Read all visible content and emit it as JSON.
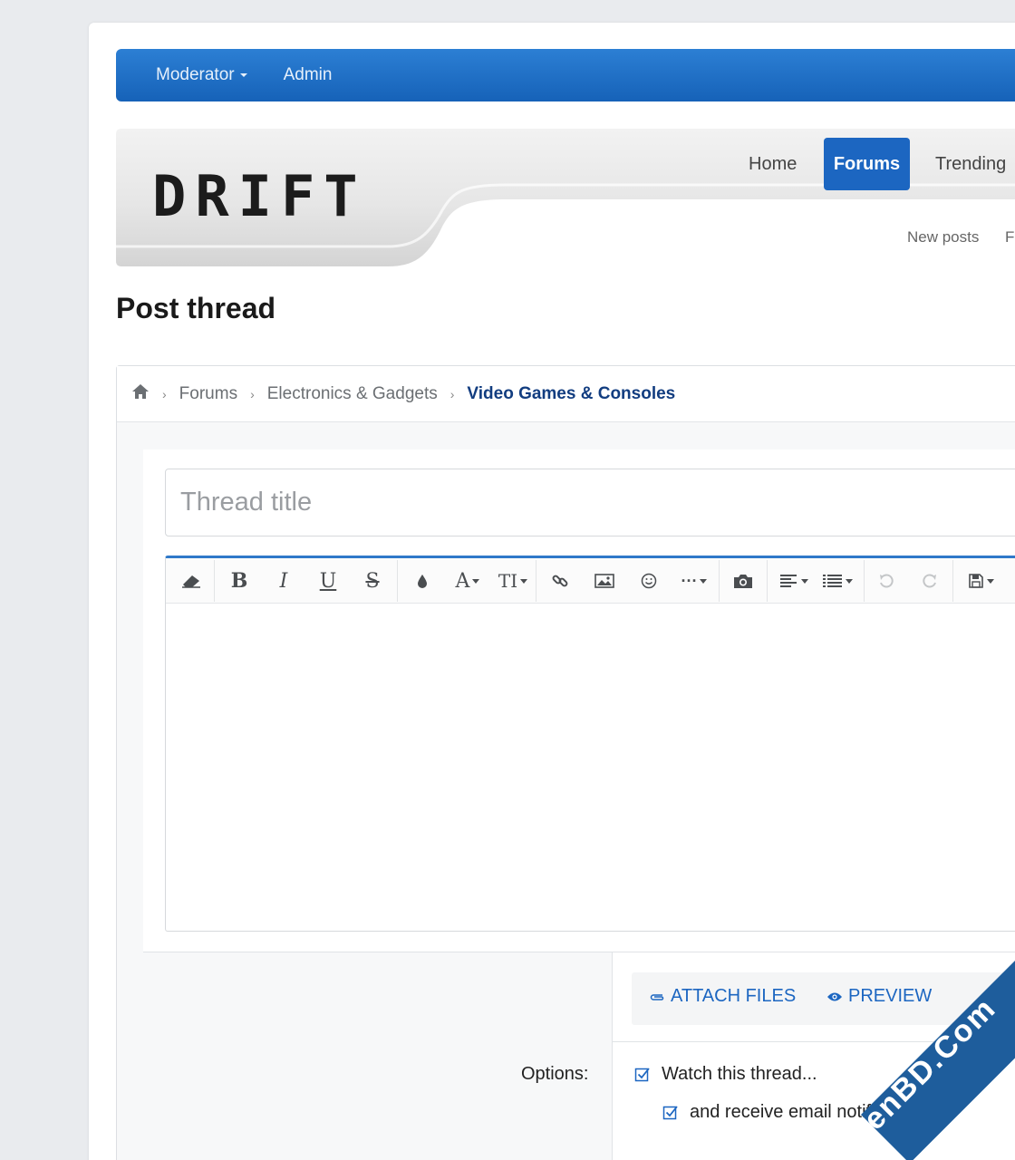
{
  "staff_bar": {
    "moderator": "Moderator",
    "admin": "Admin"
  },
  "header": {
    "logo": "DRIFT"
  },
  "nav": {
    "home": "Home",
    "forums": "Forums",
    "trending": "Trending"
  },
  "subnav": {
    "new_posts": "New posts",
    "next_partial": "F"
  },
  "page": {
    "title": "Post thread"
  },
  "breadcrumb": {
    "home_icon": "home-icon",
    "items": [
      "Forums",
      "Electronics & Gadgets",
      "Video Games & Consoles"
    ]
  },
  "form": {
    "title_placeholder": "Thread title",
    "attach_files": "ATTACH FILES",
    "preview": "PREVIEW",
    "options_label": "Options:",
    "watch_thread": "Watch this thread...",
    "email_notifications": "and receive email notifications"
  },
  "toolbar": {
    "icons": [
      "eraser-icon",
      "bold-icon",
      "italic-icon",
      "underline-icon",
      "strikethrough-icon",
      "color-icon",
      "font-family-icon",
      "font-size-icon",
      "link-icon",
      "image-icon",
      "smilie-icon",
      "more-icon",
      "media-icon",
      "align-icon",
      "list-icon",
      "undo-icon",
      "redo-icon",
      "drafts-icon"
    ]
  },
  "colors": {
    "accent": "#1c66c1",
    "breadcrumb_current": "#123d80",
    "staff_bar": "#1662b8"
  },
  "watermark": {
    "text": "XenBD.Com"
  }
}
